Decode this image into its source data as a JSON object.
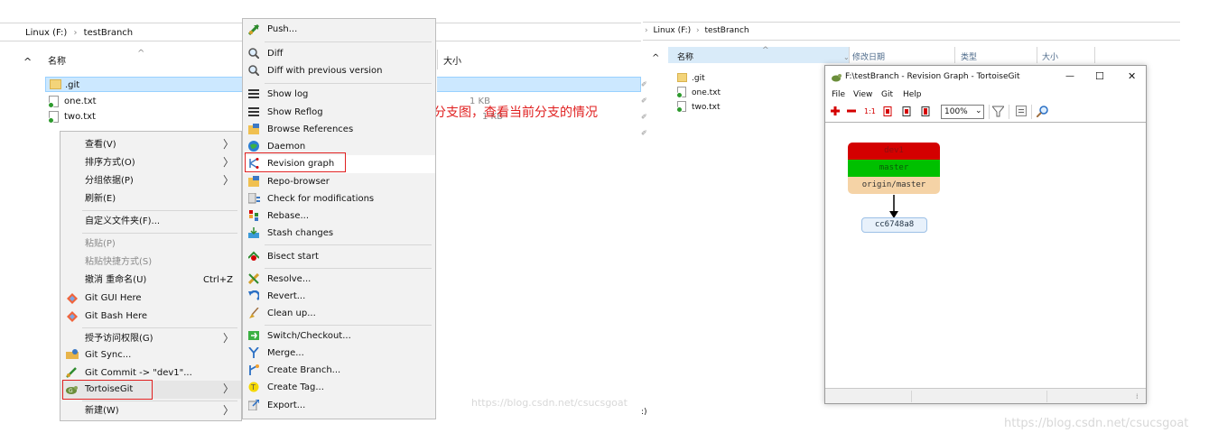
{
  "left_explorer": {
    "breadcrumb": {
      "drive": "Linux (F:)",
      "sep": "›",
      "folder": "testBranch"
    },
    "columns": {
      "name": "名称",
      "size": "大小"
    },
    "files": [
      {
        "name": ".git",
        "type": "folder"
      },
      {
        "name": "one.txt",
        "type": "file",
        "size": "1 KB"
      },
      {
        "name": "two.txt",
        "type": "file",
        "size": "1 KB"
      }
    ]
  },
  "context_menu": {
    "items": [
      {
        "label": "查看(V)",
        "submenu": true
      },
      {
        "label": "排序方式(O)",
        "submenu": true
      },
      {
        "label": "分组依据(P)",
        "submenu": true
      },
      {
        "label": "刷新(E)"
      },
      {
        "label": "自定义文件夹(F)..."
      },
      {
        "label": "粘贴(P)",
        "disabled": true
      },
      {
        "label": "粘贴快捷方式(S)",
        "disabled": true
      },
      {
        "label": "撤消 重命名(U)",
        "shortcut": "Ctrl+Z"
      },
      {
        "label": "Git GUI Here",
        "icon": "git-gui-icon"
      },
      {
        "label": "Git Bash Here",
        "icon": "git-bash-icon"
      },
      {
        "label": "授予访问权限(G)",
        "submenu": true
      },
      {
        "label": "Git Sync...",
        "icon": "git-sync-icon"
      },
      {
        "label": "Git Commit -> \"dev1\"...",
        "icon": "git-commit-icon"
      },
      {
        "label": "TortoiseGit",
        "icon": "tortoisegit-icon",
        "submenu": true,
        "highlighted": true
      },
      {
        "label": "新建(W)",
        "submenu": true
      }
    ]
  },
  "tortoise_submenu": {
    "items": [
      {
        "label": "Push...",
        "icon": "push-icon"
      },
      {
        "label": "Diff",
        "icon": "diff-icon"
      },
      {
        "label": "Diff with previous version",
        "icon": "diff-prev-icon"
      },
      {
        "label": "Show log",
        "icon": "show-log-icon"
      },
      {
        "label": "Show Reflog",
        "icon": "show-reflog-icon"
      },
      {
        "label": "Browse References",
        "icon": "browse-references-icon"
      },
      {
        "label": "Daemon",
        "icon": "daemon-icon"
      },
      {
        "label": "Revision graph",
        "icon": "revision-graph-icon",
        "highlighted": true
      },
      {
        "label": "Repo-browser",
        "icon": "repo-browser-icon"
      },
      {
        "label": "Check for modifications",
        "icon": "check-modifications-icon"
      },
      {
        "label": "Rebase...",
        "icon": "rebase-icon"
      },
      {
        "label": "Stash changes",
        "icon": "stash-icon"
      },
      {
        "label": "Bisect start",
        "icon": "bisect-icon"
      },
      {
        "label": "Resolve...",
        "icon": "resolve-icon"
      },
      {
        "label": "Revert...",
        "icon": "revert-icon"
      },
      {
        "label": "Clean up...",
        "icon": "clean-up-icon"
      },
      {
        "label": "Switch/Checkout...",
        "icon": "switch-checkout-icon"
      },
      {
        "label": "Merge...",
        "icon": "merge-icon"
      },
      {
        "label": "Create Branch...",
        "icon": "create-branch-icon"
      },
      {
        "label": "Create Tag...",
        "icon": "create-tag-icon"
      },
      {
        "label": "Export...",
        "icon": "export-icon"
      }
    ]
  },
  "annotation": {
    "text": "可以打开分支图，查看当前分支的情况",
    "color": "#e02020"
  },
  "watermark": "https://blog.csdn.net/csucsgoat",
  "right_explorer": {
    "breadcrumb": {
      "drive": "Linux (F:)",
      "sep": "›",
      "folder": "testBranch"
    },
    "columns": {
      "name": "名称",
      "modified": "修改日期",
      "type": "类型",
      "size": "大小"
    },
    "files": [
      {
        "name": ".git",
        "type": "folder"
      },
      {
        "name": "one.txt",
        "type": "file"
      },
      {
        "name": "two.txt",
        "type": "file"
      }
    ]
  },
  "revision_window": {
    "title": "F:\\testBranch - Revision Graph - TortoiseGit",
    "menu": [
      "File",
      "View",
      "Git",
      "Help"
    ],
    "zoom": "100%",
    "refs": [
      {
        "name": "dev1",
        "color": "#d40000"
      },
      {
        "name": "master",
        "color": "#00c000"
      },
      {
        "name": "origin/master",
        "color": "#f5d3a6"
      }
    ],
    "commit": "cc6748a8",
    "controls": {
      "minimize": "—",
      "maximize": "☐",
      "close": "✕"
    }
  },
  "colors": {
    "menu_bg": "#f2f2f2",
    "selection": "#cce8ff",
    "accent_red": "#e02020"
  }
}
